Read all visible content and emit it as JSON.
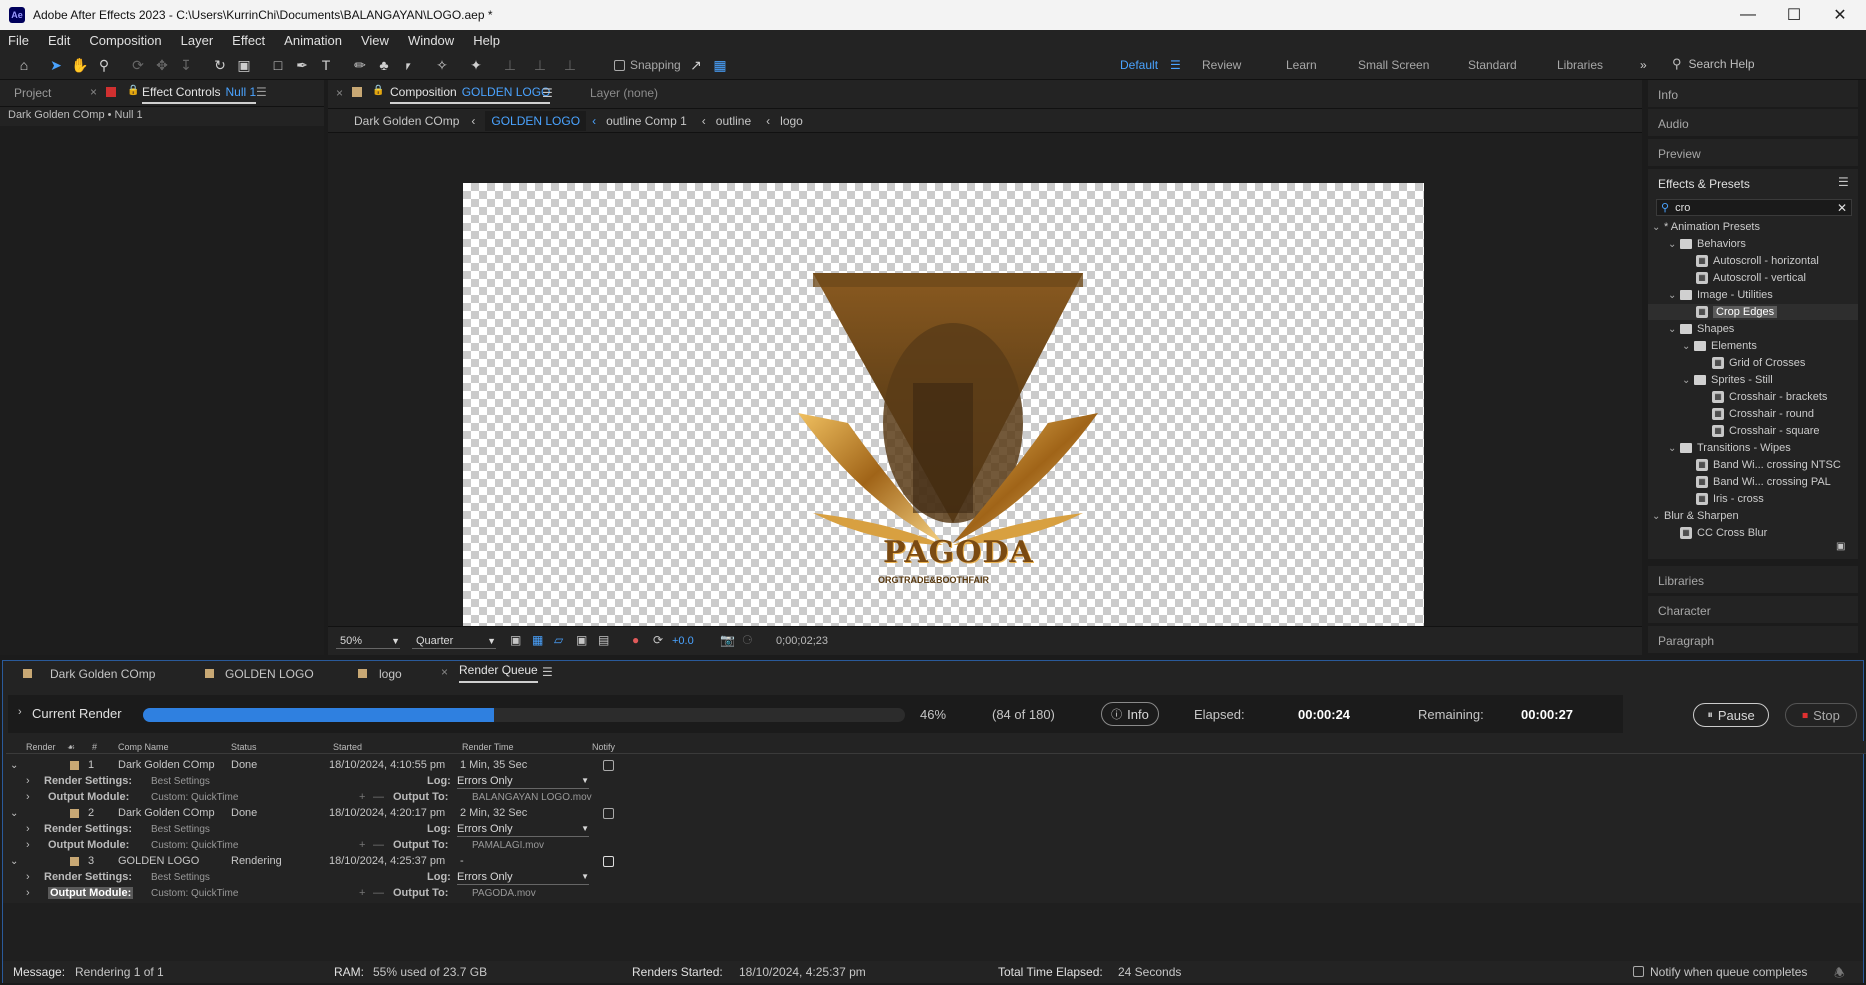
{
  "window": {
    "title": "Adobe After Effects 2023 - C:\\Users\\KurrinChi\\Documents\\BALANGAYAN\\LOGO.aep *",
    "app_badge": "Ae"
  },
  "menu": [
    "File",
    "Edit",
    "Composition",
    "Layer",
    "Effect",
    "Animation",
    "View",
    "Window",
    "Help"
  ],
  "toolbar": {
    "snapping_label": "Snapping"
  },
  "workspaces": [
    "Default",
    "Review",
    "Learn",
    "Small Screen",
    "Standard",
    "Libraries"
  ],
  "search_help": "Search Help",
  "left_panel": {
    "tab_project": "Project",
    "tab_effect_controls": "Effect Controls",
    "tab_effect_target": "Null 1",
    "breadcrumb": "Dark Golden COmp • Null 1"
  },
  "comp_panel": {
    "tab_prefix": "Composition",
    "tab_name": "GOLDEN LOGO",
    "layer_tab": "Layer (none)",
    "flow": [
      "Dark Golden COmp",
      "GOLDEN LOGO",
      "outline Comp 1",
      "outline",
      "logo"
    ],
    "zoom": "50%",
    "resolution": "Quarter",
    "exposure": "+0.0",
    "timecode": "0;00;02;23",
    "logo_text": "PAGODA",
    "logo_subtext": "ORGTRADE&BOOTHFAIR"
  },
  "right_panel": {
    "tabs_top": [
      "Info",
      "Audio",
      "Preview"
    ],
    "effects_title": "Effects & Presets",
    "search_value": "cro",
    "tree": [
      {
        "label": "* Animation Presets",
        "type": "group",
        "depth": 0
      },
      {
        "label": "Behaviors",
        "type": "folder",
        "depth": 1
      },
      {
        "label": "Autoscroll - horizontal",
        "type": "preset",
        "depth": 2
      },
      {
        "label": "Autoscroll - vertical",
        "type": "preset",
        "depth": 2
      },
      {
        "label": "Image - Utilities",
        "type": "folder",
        "depth": 1
      },
      {
        "label": "Crop Edges",
        "type": "preset",
        "depth": 2,
        "selected": true
      },
      {
        "label": "Shapes",
        "type": "folder",
        "depth": 1
      },
      {
        "label": "Elements",
        "type": "folder",
        "depth": 2
      },
      {
        "label": "Grid of Crosses",
        "type": "preset",
        "depth": 3
      },
      {
        "label": "Sprites - Still",
        "type": "folder",
        "depth": 2
      },
      {
        "label": "Crosshair - brackets",
        "type": "preset",
        "depth": 3
      },
      {
        "label": "Crosshair - round",
        "type": "preset",
        "depth": 3
      },
      {
        "label": "Crosshair - square",
        "type": "preset",
        "depth": 3
      },
      {
        "label": "Transitions - Wipes",
        "type": "folder",
        "depth": 1
      },
      {
        "label": "Band Wi... crossing NTSC",
        "type": "preset",
        "depth": 2
      },
      {
        "label": "Band Wi... crossing PAL",
        "type": "preset",
        "depth": 2
      },
      {
        "label": "Iris - cross",
        "type": "preset",
        "depth": 2
      },
      {
        "label": "Blur & Sharpen",
        "type": "group",
        "depth": 0
      },
      {
        "label": "CC Cross Blur",
        "type": "preset",
        "depth": 1
      }
    ],
    "tabs_bottom": [
      "Libraries",
      "Character",
      "Paragraph"
    ]
  },
  "bottom_tabs": [
    "Dark Golden COmp",
    "GOLDEN LOGO",
    "logo",
    "Render Queue"
  ],
  "render": {
    "current_label": "Current Render",
    "progress": 0.46,
    "percent": "46%",
    "frames": "(84 of 180)",
    "info_label": "Info",
    "elapsed_label": "Elapsed:",
    "elapsed": "00:00:24",
    "remaining_label": "Remaining:",
    "remaining": "00:00:27",
    "pause_label": "Pause",
    "stop_label": "Stop"
  },
  "queue": {
    "headers": [
      "Render",
      "#",
      "Comp Name",
      "Status",
      "Started",
      "Render Time",
      "Notify"
    ],
    "items": [
      {
        "num": "1",
        "comp": "Dark Golden COmp",
        "status": "Done",
        "started": "18/10/2024, 4:10:55 pm",
        "time": "1 Min, 35 Sec",
        "settings": "Best Settings",
        "log": "Errors Only",
        "module": "Custom: QuickTime",
        "output": "BALANGAYAN LOGO.mov"
      },
      {
        "num": "2",
        "comp": "Dark Golden COmp",
        "status": "Done",
        "started": "18/10/2024, 4:20:17 pm",
        "time": "2 Min, 32 Sec",
        "settings": "Best Settings",
        "log": "Errors Only",
        "module": "Custom: QuickTime",
        "output": "PAMALAGI.mov"
      },
      {
        "num": "3",
        "comp": "GOLDEN LOGO",
        "status": "Rendering",
        "started": "18/10/2024, 4:25:37 pm",
        "time": "-",
        "settings": "Best Settings",
        "log": "Errors Only",
        "module": "Custom: QuickTime",
        "output": "PAGODA.mov"
      }
    ],
    "rs_label": "Render Settings:",
    "om_label": "Output Module:",
    "log_label": "Log:",
    "out_label": "Output To:"
  },
  "status": {
    "message_label": "Message:",
    "message": "Rendering 1 of 1",
    "ram_label": "RAM:",
    "ram": "55% used of 23.7 GB",
    "started_label": "Renders Started:",
    "started": "18/10/2024, 4:25:37 pm",
    "total_label": "Total Time Elapsed:",
    "total": "24 Seconds",
    "notify_label": "Notify when queue completes"
  }
}
